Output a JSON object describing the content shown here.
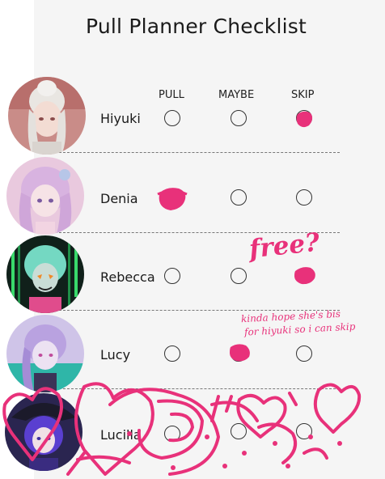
{
  "title": "Pull Planner Checklist",
  "columns": [
    "PULL",
    "MAYBE",
    "SKIP"
  ],
  "rows": [
    {
      "name": "Hiyuki",
      "choice": "SKIP"
    },
    {
      "name": "Denia",
      "choice": "PULL"
    },
    {
      "name": "Rebecca",
      "choice": "SKIP"
    },
    {
      "name": "Lucy",
      "choice": "MAYBE"
    },
    {
      "name": "Lucilla",
      "choice": ""
    }
  ],
  "annotations": {
    "free_note": "free?",
    "hope_note_line1": "kinda hope she's bis",
    "hope_note_line2": "for hiyuki so i can skip"
  },
  "colors": {
    "ink": "#e8317a",
    "sheet": "#f5f5f5"
  }
}
